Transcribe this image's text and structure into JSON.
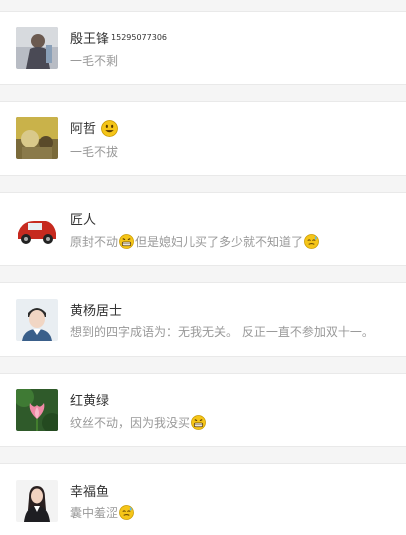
{
  "comments": [
    {
      "name": "殷王锋",
      "extra": "15295077306",
      "text_parts": [
        "一毛不剩"
      ],
      "name_emoji": null
    },
    {
      "name": "阿哲",
      "extra": "",
      "text_parts": [
        "一毛不拔"
      ],
      "name_emoji": "smile-emoji"
    },
    {
      "name": "匠人",
      "extra": "",
      "text_parts": [
        "原封不动",
        "但是媳妇儿买了多少就不知道了"
      ],
      "name_emoji": null
    },
    {
      "name": "黄杨居士",
      "extra": "",
      "text_parts": [
        "想到的四字成语为：无我无关。 反正一直不参加双十一。"
      ],
      "name_emoji": null
    },
    {
      "name": "红黄绿",
      "extra": "",
      "text_parts": [
        "纹丝不动，因为我没买"
      ],
      "name_emoji": null
    },
    {
      "name": "幸福鱼",
      "extra": "",
      "text_parts": [
        "囊中羞涩"
      ],
      "name_emoji": null
    }
  ],
  "colors": {
    "separator": "#f5f5f5",
    "name": "#333333",
    "message": "#999999"
  }
}
